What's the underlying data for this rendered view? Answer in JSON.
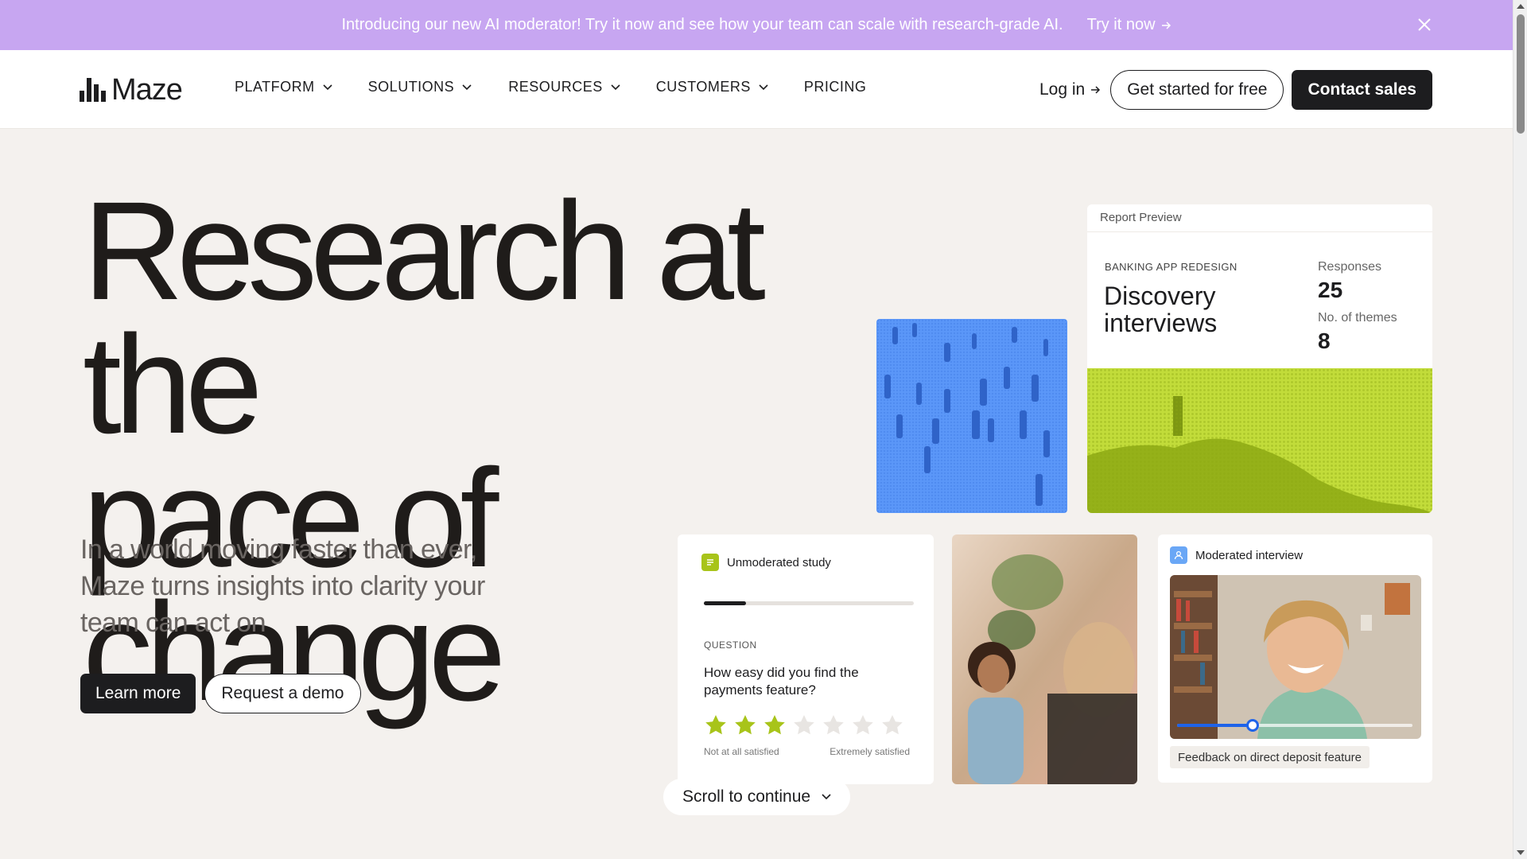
{
  "announcement": {
    "message": "Introducing our new AI moderator! Try it now and see how your team can scale with research-grade AI.",
    "link": "Try it now",
    "bg_color": "#c7a6f1"
  },
  "nav": {
    "logo": "Maze",
    "items": [
      {
        "label": "PLATFORM",
        "dropdown": true
      },
      {
        "label": "SOLUTIONS",
        "dropdown": true
      },
      {
        "label": "RESOURCES",
        "dropdown": true
      },
      {
        "label": "CUSTOMERS",
        "dropdown": true
      },
      {
        "label": "PRICING",
        "dropdown": false
      }
    ],
    "login": "Log in",
    "get_started": "Get started for free",
    "contact": "Contact sales"
  },
  "hero": {
    "title_line1": "Research at the",
    "title_line2": "pace of change",
    "subtitle": "In a world moving faster than ever, Maze turns insights into clarity your team can act on",
    "learn_more": "Learn more",
    "request_demo": "Request a demo"
  },
  "report": {
    "label": "Report Preview",
    "category": "BANKING APP REDESIGN",
    "title": "Discovery interviews",
    "responses_label": "Responses",
    "responses_value": "25",
    "themes_label": "No. of themes",
    "themes_value": "8"
  },
  "unmoderated": {
    "badge": "Unmoderated study",
    "progress": 0.2,
    "question_label": "QUESTION",
    "question": "How easy did you find the payments feature?",
    "rating": 3,
    "max_rating": 7,
    "scale_low": "Not at all satisfied",
    "scale_high": "Extremely satisfied"
  },
  "moderated": {
    "badge": "Moderated interview",
    "caption": "Feedback on direct deposit feature",
    "video_progress": 0.32
  },
  "scroll": {
    "label": "Scroll to continue"
  },
  "colors": {
    "accent_green": "#a8c41a",
    "accent_blue": "#4f8ff7",
    "dark": "#1d1d1f"
  }
}
